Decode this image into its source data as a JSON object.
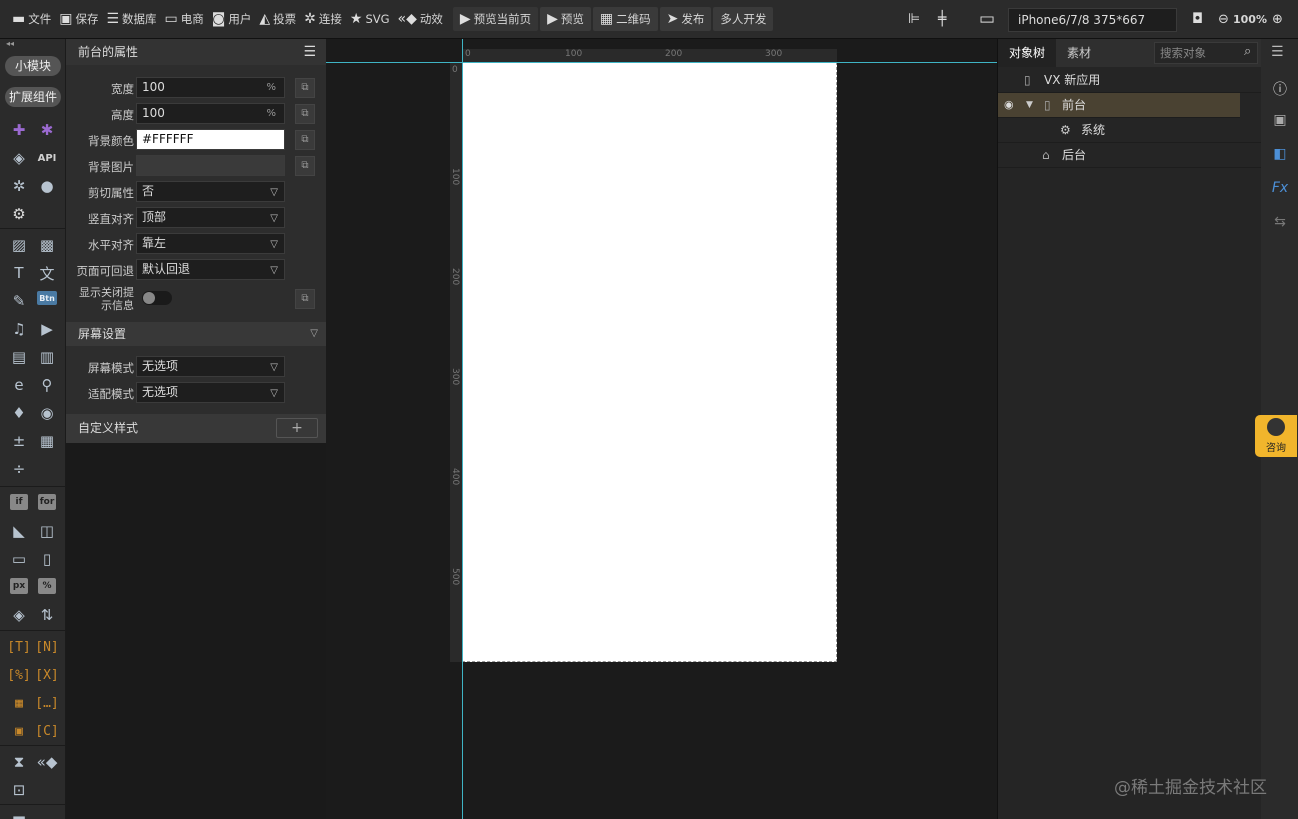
{
  "toolbar": {
    "file": "文件",
    "save": "保存",
    "database": "数据库",
    "ecommerce": "电商",
    "user": "用户",
    "vote": "投票",
    "connect": "连接",
    "svg": "SVG",
    "animation": "动效",
    "preview_current": "预览当前页",
    "preview": "预览",
    "qrcode": "二维码",
    "publish": "发布",
    "multi_dev": "多人开发",
    "device": "iPhone6/7/8 375*667",
    "zoom": "100%"
  },
  "leftbar": {
    "small_module": "小模块",
    "extend": "扩展组件",
    "api": "API",
    "if": "if",
    "for": "for",
    "btn": "Btn",
    "px": "px",
    "pct": "%"
  },
  "props": {
    "title": "前台的属性",
    "width_label": "宽度",
    "width_value": "100",
    "width_unit": "%",
    "height_label": "高度",
    "height_value": "100",
    "height_unit": "%",
    "bgcolor_label": "背景颜色",
    "bgcolor_value": "#FFFFFF",
    "bgimage_label": "背景图片",
    "clip_label": "剪切属性",
    "clip_value": "否",
    "valign_label": "竖直对齐",
    "valign_value": "顶部",
    "halign_label": "水平对齐",
    "halign_value": "靠左",
    "back_label": "页面可回退",
    "back_value": "默认回退",
    "close_tip_label_1": "显示关闭提",
    "close_tip_label_2": "示信息",
    "screen_section": "屏幕设置",
    "screen_mode_label": "屏幕模式",
    "screen_mode_value": "无选项",
    "fit_mode_label": "适配模式",
    "fit_mode_value": "无选项",
    "custom_style": "自定义样式",
    "add_symbol": "+"
  },
  "ruler": {
    "top": [
      "0",
      "100",
      "200",
      "300"
    ],
    "left": [
      "0",
      "100",
      "200",
      "300",
      "400",
      "500"
    ]
  },
  "tree": {
    "tab_objects": "对象树",
    "tab_assets": "素材",
    "search_placeholder": "搜索对象",
    "nodes": {
      "app": "VX 新应用",
      "front": "前台",
      "system": "系统",
      "back": "后台"
    }
  },
  "consult": "咨询",
  "watermark": "@稀土掘金技术社区",
  "colors": {
    "accent_guide": "#3fb4c4",
    "consult_bg": "#f1b52c",
    "selected_node": "#4a4232"
  }
}
